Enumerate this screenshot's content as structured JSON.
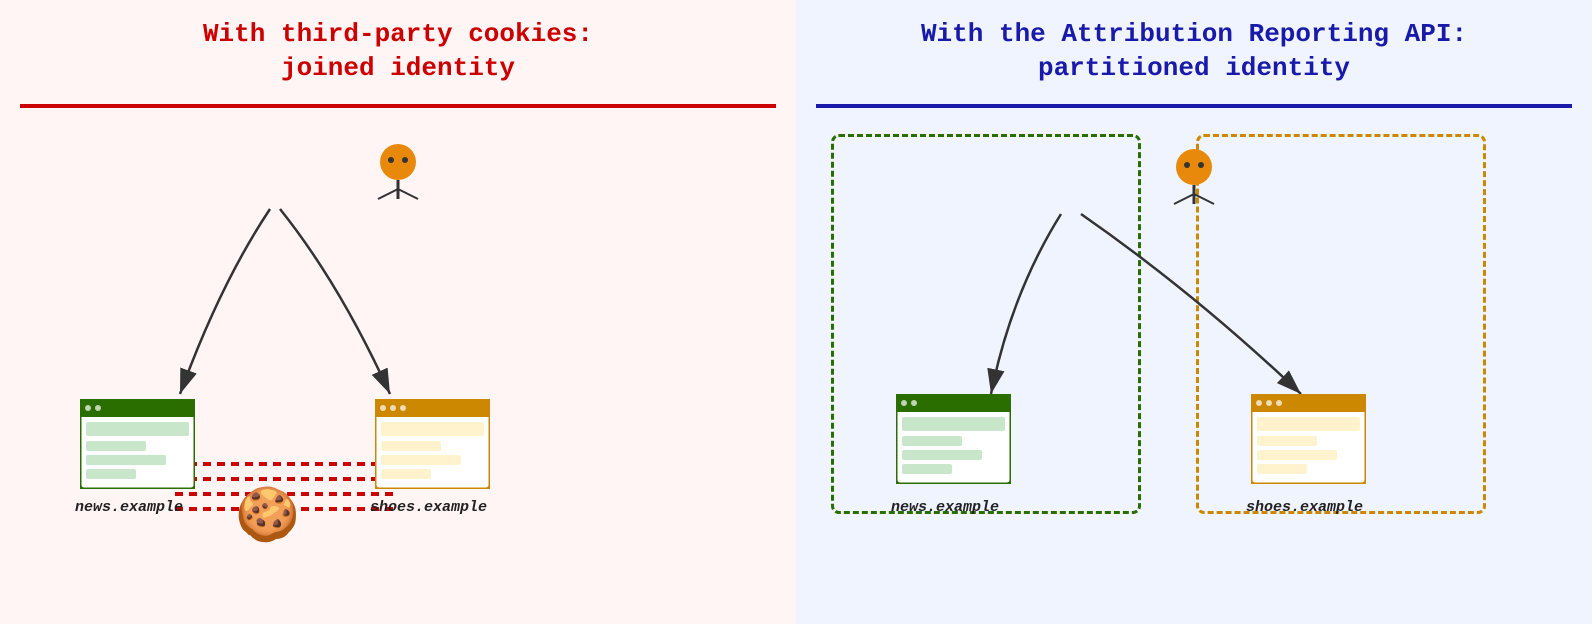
{
  "left_panel": {
    "title_line1": "With third-party cookies:",
    "title_line2": "joined identity",
    "bg": "#fff5f5",
    "title_color": "#cc0000",
    "divider_color": "#cc0000",
    "site1_label": "news.example",
    "site2_label": "shoes.example"
  },
  "right_panel": {
    "title_line1": "With the Attribution Reporting API:",
    "title_line2": "partitioned identity",
    "bg": "#f0f4ff",
    "title_color": "#1a1aaa",
    "divider_color": "#1a1aaa",
    "site1_label": "news.example",
    "site2_label": "shoes.example",
    "box1_color": "#2a6e00",
    "box2_color": "#cc8800"
  }
}
